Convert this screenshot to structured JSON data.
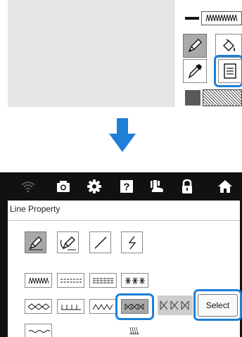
{
  "top_panel": {
    "canvas": {},
    "line_preview": {
      "icon": "zigzag-stitch"
    },
    "tools": [
      {
        "name": "pen-icon",
        "state": "selected"
      },
      {
        "name": "fill-bucket-icon"
      },
      {
        "name": "eyedropper-icon"
      },
      {
        "name": "line-property-icon",
        "highlighted": true
      }
    ],
    "swatches": {
      "color": "#5a5a5a",
      "pattern": "hatched"
    }
  },
  "arrow": {
    "color": "#1e7fd8",
    "direction": "down"
  },
  "header_icons": [
    "wifi-icon",
    "camera-icon",
    "gear-icon",
    "help-icon",
    "foot-icon",
    "lock-icon",
    "home-icon"
  ],
  "dialog": {
    "title": "Line Property",
    "select_label": "Select",
    "help_label": "?",
    "mode_buttons": [
      {
        "name": "pen-icon",
        "state": "selected"
      },
      {
        "name": "pen-curve-icon"
      },
      {
        "name": "straight-line-icon"
      },
      {
        "name": "zigzag-line-icon"
      }
    ],
    "patterns": [
      "zigzag-stitch",
      "dashed-double-stitch",
      "triple-dashed-stitch",
      "cross-stitch",
      "diamond-stitch",
      "blanket-stitch",
      "wave-v-stitch",
      "feather-cross-stitch",
      "wave-stitch",
      "decorative-stitch"
    ],
    "selected_pattern": "feather-cross-stitch",
    "preview_pattern": "feather-cross-stitch"
  },
  "colors": {
    "highlight": "#1e7fd8",
    "header_bg": "#111111",
    "selected_bg": "#a9a9a9"
  }
}
